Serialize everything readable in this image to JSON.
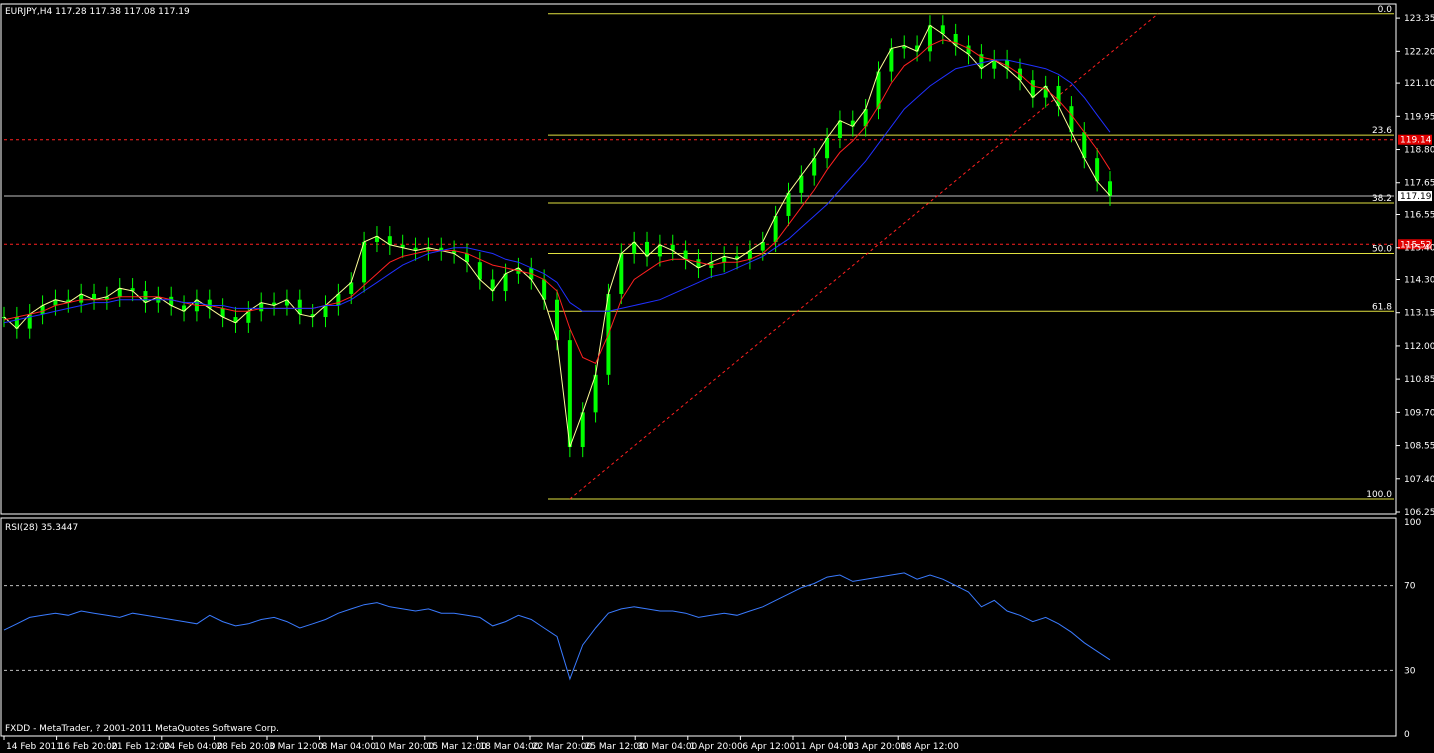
{
  "header": {
    "symbol_info": "EURJPY,H4  117.28 117.38 117.08 117.19",
    "rsi_label": "RSI(28) 35.3447",
    "footer": "FXDD - MetaTrader, ? 2001-2011 MetaQuotes Software Corp."
  },
  "colors": {
    "background": "#000000",
    "frame": "#ffffff",
    "candle": "#00ff00",
    "ma_fast": "#ffff99",
    "ma_mid": "#ff2020",
    "ma_slow": "#2030ff",
    "fib": "#e0e040",
    "dashed_level": "#ff2020",
    "rsi_line": "#3a7bff"
  },
  "chart_data": [
    {
      "type": "line",
      "title": "EURJPY,H4",
      "ylim": [
        106.25,
        123.7
      ],
      "y_ticks": [
        "123.35",
        "122.20",
        "121.10",
        "119.95",
        "118.80",
        "117.65",
        "116.55",
        "115.40",
        "114.30",
        "113.15",
        "112.00",
        "110.85",
        "109.70",
        "108.55",
        "107.40",
        "106.25"
      ],
      "x_ticks": [
        "14 Feb 2011",
        "16 Feb 20:00",
        "21 Feb 12:00",
        "24 Feb 04:00",
        "28 Feb 20:00",
        "3 Mar 12:00",
        "8 Mar 04:00",
        "10 Mar 20:00",
        "15 Mar 12:00",
        "18 Mar 04:00",
        "22 Mar 20:00",
        "25 Mar 12:00",
        "30 Mar 04:00",
        "1 Apr 20:00",
        "6 Apr 12:00",
        "11 Apr 04:00",
        "13 Apr 20:00",
        "18 Apr 12:00"
      ],
      "current_price": "117.19",
      "price_tags": [
        {
          "label": "119.14",
          "value": 119.14
        },
        {
          "label": "115.52",
          "value": 115.52
        }
      ],
      "fibonacci": [
        {
          "label": "0.0",
          "value": 123.5
        },
        {
          "label": "23.6",
          "value": 119.3
        },
        {
          "label": "38.2",
          "value": 116.95
        },
        {
          "label": "50.0",
          "value": 115.2
        },
        {
          "label": "61.8",
          "value": 113.2
        },
        {
          "label": "100.0",
          "value": 106.7
        }
      ],
      "series": [
        {
          "role": "price",
          "values": [
            113.0,
            112.6,
            113.1,
            113.4,
            113.6,
            113.5,
            113.8,
            113.6,
            113.7,
            114.0,
            113.9,
            113.5,
            113.7,
            113.4,
            113.2,
            113.6,
            113.3,
            113.0,
            112.8,
            113.2,
            113.5,
            113.4,
            113.6,
            113.1,
            113.0,
            113.4,
            113.8,
            114.2,
            115.6,
            115.8,
            115.5,
            115.4,
            115.3,
            115.4,
            115.3,
            115.2,
            114.9,
            114.3,
            113.9,
            114.5,
            114.7,
            114.3,
            113.6,
            112.2,
            108.5,
            109.7,
            111.0,
            113.8,
            115.2,
            115.6,
            115.1,
            115.5,
            115.3,
            115.0,
            114.7,
            114.9,
            115.1,
            115.0,
            115.3,
            115.6,
            116.5,
            117.3,
            117.9,
            118.5,
            119.2,
            119.8,
            119.6,
            120.2,
            121.5,
            122.3,
            122.4,
            122.2,
            123.1,
            122.8,
            122.4,
            122.1,
            121.6,
            121.9,
            121.6,
            121.2,
            120.6,
            121.0,
            120.3,
            119.4,
            118.5,
            117.7,
            117.2
          ]
        },
        {
          "role": "ma_mid",
          "values": [
            112.9,
            113.0,
            113.1,
            113.2,
            113.4,
            113.5,
            113.6,
            113.6,
            113.6,
            113.7,
            113.7,
            113.7,
            113.7,
            113.6,
            113.5,
            113.4,
            113.4,
            113.3,
            113.2,
            113.2,
            113.3,
            113.3,
            113.3,
            113.3,
            113.3,
            113.4,
            113.5,
            113.7,
            114.1,
            114.5,
            114.9,
            115.1,
            115.2,
            115.3,
            115.3,
            115.3,
            115.2,
            115.0,
            114.8,
            114.7,
            114.6,
            114.5,
            114.3,
            113.9,
            112.6,
            111.6,
            111.4,
            112.4,
            113.6,
            114.3,
            114.6,
            114.9,
            115.0,
            115.0,
            114.9,
            114.8,
            114.9,
            114.9,
            115.0,
            115.2,
            115.6,
            116.2,
            116.8,
            117.4,
            118.1,
            118.7,
            119.1,
            119.6,
            120.3,
            121.1,
            121.7,
            122.0,
            122.4,
            122.6,
            122.5,
            122.3,
            122.0,
            121.9,
            121.7,
            121.4,
            121.0,
            120.9,
            120.5,
            120.0,
            119.4,
            118.8,
            118.1
          ]
        },
        {
          "role": "ma_slow",
          "values": [
            112.8,
            112.9,
            113.0,
            113.1,
            113.2,
            113.3,
            113.4,
            113.5,
            113.5,
            113.6,
            113.6,
            113.6,
            113.6,
            113.6,
            113.5,
            113.5,
            113.4,
            113.4,
            113.3,
            113.3,
            113.3,
            113.3,
            113.3,
            113.3,
            113.3,
            113.4,
            113.4,
            113.6,
            113.9,
            114.2,
            114.5,
            114.8,
            115.0,
            115.2,
            115.3,
            115.4,
            115.4,
            115.3,
            115.2,
            115.0,
            114.9,
            114.7,
            114.5,
            114.2,
            113.5,
            113.2,
            113.2,
            113.2,
            113.3,
            113.4,
            113.5,
            113.6,
            113.8,
            114.0,
            114.2,
            114.4,
            114.5,
            114.7,
            114.9,
            115.1,
            115.4,
            115.7,
            116.1,
            116.5,
            116.9,
            117.4,
            117.9,
            118.4,
            119.0,
            119.6,
            120.2,
            120.6,
            121.0,
            121.3,
            121.6,
            121.7,
            121.8,
            121.9,
            121.9,
            121.8,
            121.7,
            121.6,
            121.4,
            121.1,
            120.6,
            120.0,
            119.4
          ]
        }
      ]
    },
    {
      "type": "line",
      "title": "RSI(28) 35.3447",
      "ylim": [
        0,
        100
      ],
      "y_ticks": [
        "100",
        "70",
        "30",
        "0"
      ],
      "levels": [
        70,
        30
      ],
      "series": [
        {
          "role": "rsi",
          "values": [
            49,
            52,
            55,
            56,
            57,
            56,
            58,
            57,
            56,
            55,
            57,
            56,
            55,
            54,
            53,
            52,
            56,
            53,
            51,
            52,
            54,
            55,
            53,
            50,
            52,
            54,
            57,
            59,
            61,
            62,
            60,
            59,
            58,
            59,
            57,
            57,
            56,
            55,
            51,
            53,
            56,
            54,
            50,
            46,
            26,
            42,
            50,
            57,
            59,
            60,
            59,
            58,
            58,
            57,
            55,
            56,
            57,
            56,
            58,
            60,
            63,
            66,
            69,
            71,
            74,
            75,
            72,
            73,
            74,
            75,
            76,
            73,
            75,
            73,
            70,
            67,
            60,
            63,
            58,
            56,
            53,
            55,
            52,
            48,
            43,
            39,
            35
          ]
        }
      ]
    }
  ]
}
